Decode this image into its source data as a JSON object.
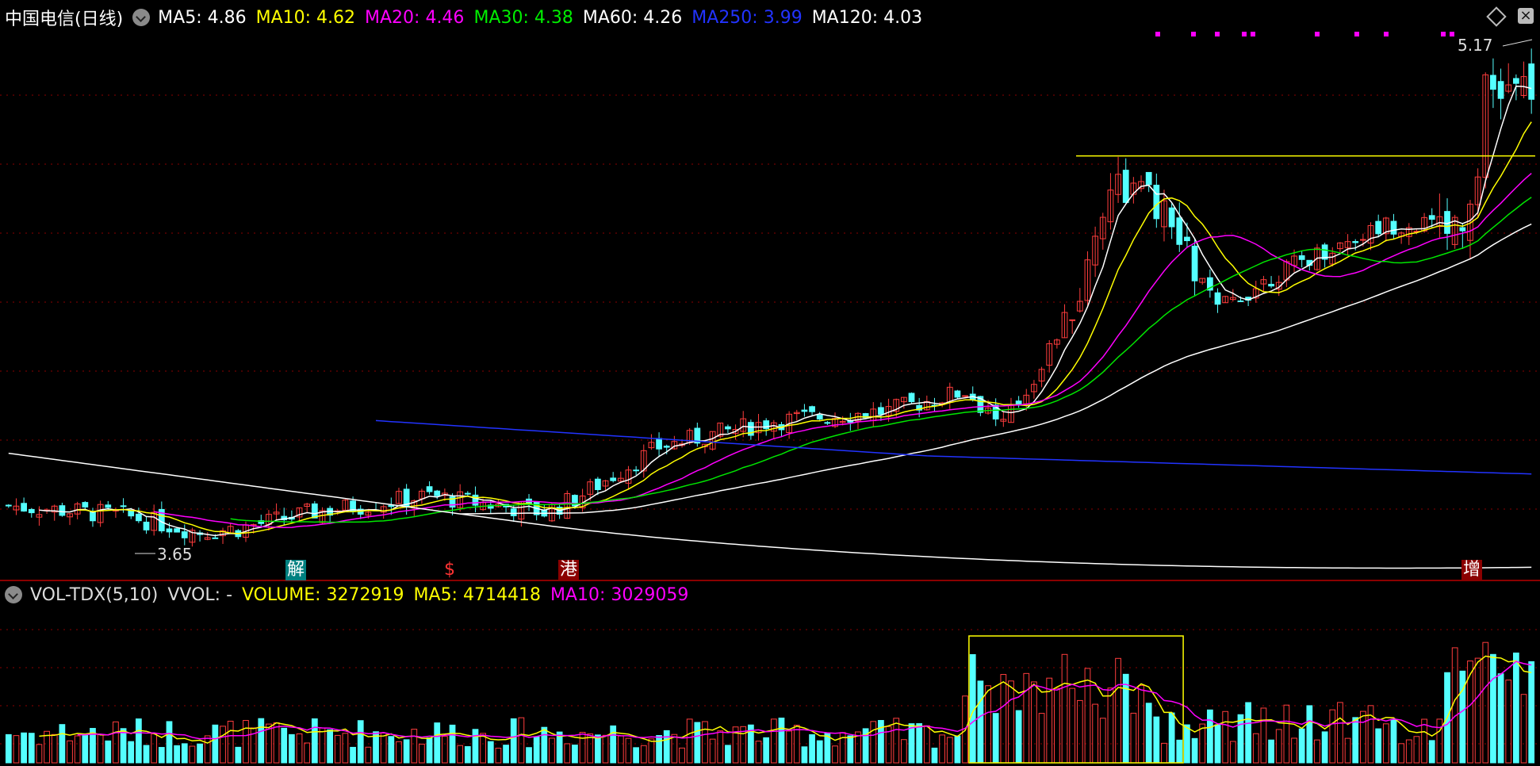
{
  "main_header": {
    "title": "中国电信(日线)",
    "ma_labels": [
      {
        "text": "MA5: 4.86",
        "color": "#ffffff"
      },
      {
        "text": "MA10: 4.62",
        "color": "#ffff00"
      },
      {
        "text": "MA20: 4.46",
        "color": "#ff00ff"
      },
      {
        "text": "MA30: 4.38",
        "color": "#00e600"
      },
      {
        "text": "MA60: 4.26",
        "color": "#ffffff"
      },
      {
        "text": "MA250: 3.99",
        "color": "#2233ff"
      },
      {
        "text": "MA120: 4.03",
        "color": "#ffffff"
      }
    ]
  },
  "sub_header": {
    "labels": [
      {
        "text": "VOL-TDX(5,10)",
        "color": "#dddddd"
      },
      {
        "text": "VVOL: -",
        "color": "#dddddd"
      },
      {
        "text": "VOLUME: 3272919",
        "color": "#ffff00"
      },
      {
        "text": "MA5: 4714418",
        "color": "#ffff00"
      },
      {
        "text": "MA10: 3029059",
        "color": "#ff00ff"
      }
    ]
  },
  "annotations": {
    "high_label": "5.17",
    "low_label": "3.65",
    "events": [
      {
        "text": "解",
        "bg": "#008080",
        "color": "#ffffff"
      },
      {
        "text": "$",
        "bg": "#000000",
        "color": "#ff3333"
      },
      {
        "text": "港",
        "bg": "#8b0000",
        "color": "#ffffff"
      },
      {
        "text": "增",
        "bg": "#8b0000",
        "color": "#ffffff"
      }
    ]
  },
  "colors": {
    "up": "#ff3d3d",
    "down": "#54ffff",
    "ma5": "#ffffff",
    "ma10": "#ffff00",
    "ma20": "#ff00ff",
    "ma30": "#00e600",
    "ma60": "#ffffff",
    "ma120": "#ffffff",
    "ma250": "#2233ff",
    "grid": "#8b0000",
    "box": "#ffff00"
  },
  "chart_data": {
    "type": "candlestick",
    "ylim": [
      3.6,
      5.25
    ],
    "high": 5.17,
    "low": 3.65,
    "resistance_level": 4.87,
    "candle_count": 200
  }
}
